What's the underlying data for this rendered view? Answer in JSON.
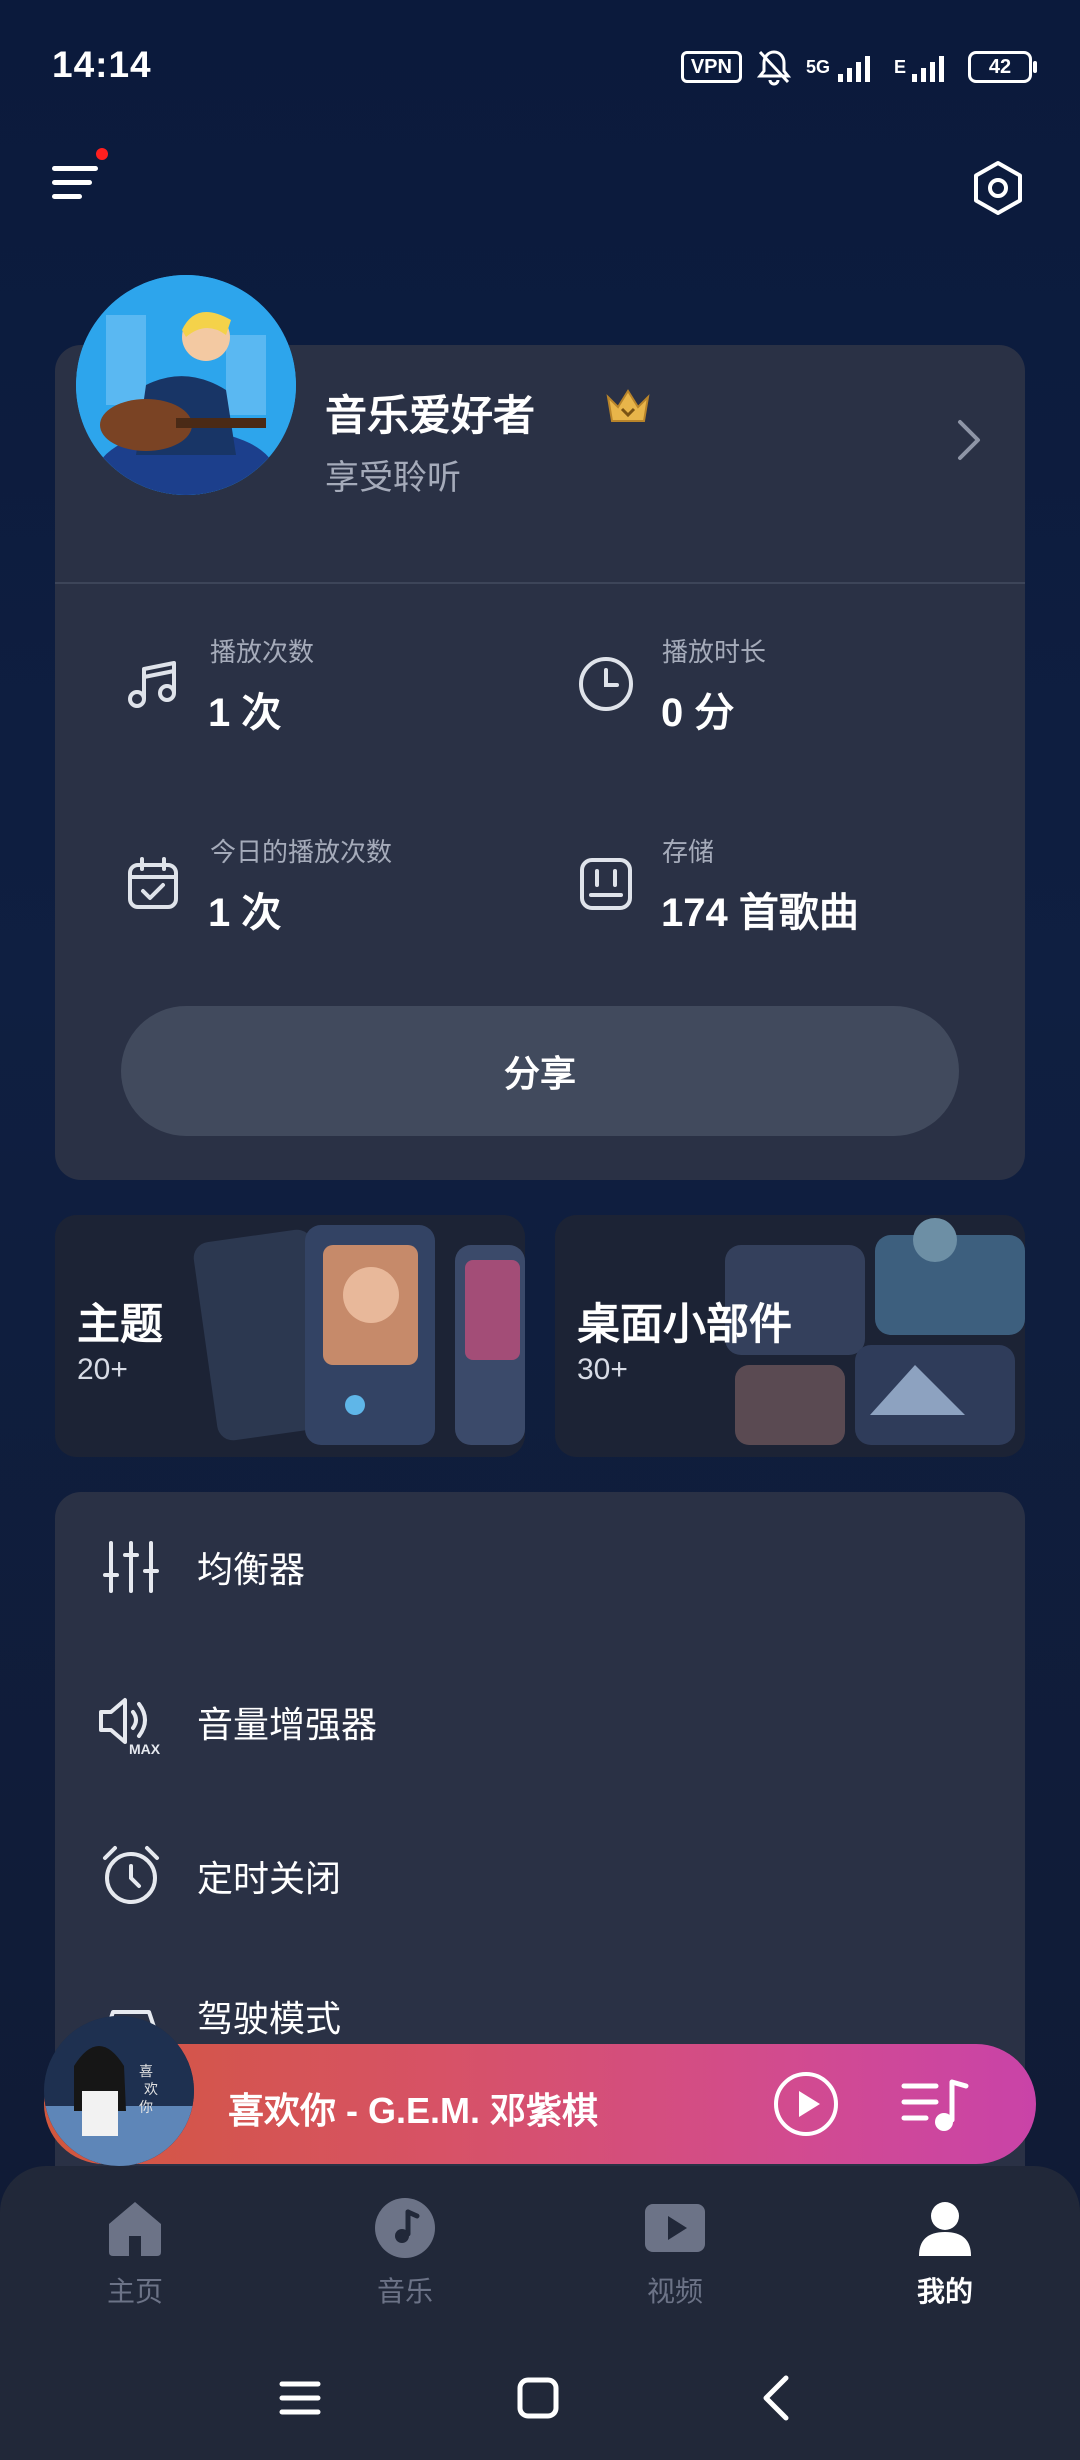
{
  "status_bar": {
    "time": "14:14",
    "vpn": "VPN",
    "network": "5G",
    "network2": "E",
    "battery": "42"
  },
  "profile": {
    "name": "音乐爱好者",
    "tagline": "享受聆听"
  },
  "stats": [
    {
      "icon": "music-note-icon",
      "label": "播放次数",
      "value": "1 次"
    },
    {
      "icon": "clock-icon",
      "label": "播放时长",
      "value": "0 分"
    },
    {
      "icon": "calendar-check-icon",
      "label": "今日的播放次数",
      "value": "1 次"
    },
    {
      "icon": "storage-icon",
      "label": "存储",
      "value": "174 首歌曲"
    }
  ],
  "share_label": "分享",
  "tiles": [
    {
      "title": "主题",
      "subtitle": "20+"
    },
    {
      "title": "桌面小部件",
      "subtitle": "30+"
    }
  ],
  "menu": [
    {
      "icon": "equalizer-icon",
      "label": "均衡器"
    },
    {
      "icon": "volume-max-icon",
      "label": "音量增强器"
    },
    {
      "icon": "alarm-icon",
      "label": "定时关闭"
    },
    {
      "icon": "car-icon",
      "label": "驾驶模式"
    }
  ],
  "player": {
    "title": "喜欢你 - G.E.M. 邓紫棋"
  },
  "nav": [
    {
      "icon": "home-icon",
      "label": "主页"
    },
    {
      "icon": "music-icon",
      "label": "音乐"
    },
    {
      "icon": "video-icon",
      "label": "视频"
    },
    {
      "icon": "profile-icon",
      "label": "我的"
    }
  ],
  "colors": {
    "background": "#0f1f41",
    "card": "#2a3145",
    "player_start": "#d2573d",
    "player_end": "#c943a8",
    "nav_active": "#ffffff",
    "nav_inactive": "#6c7387"
  }
}
